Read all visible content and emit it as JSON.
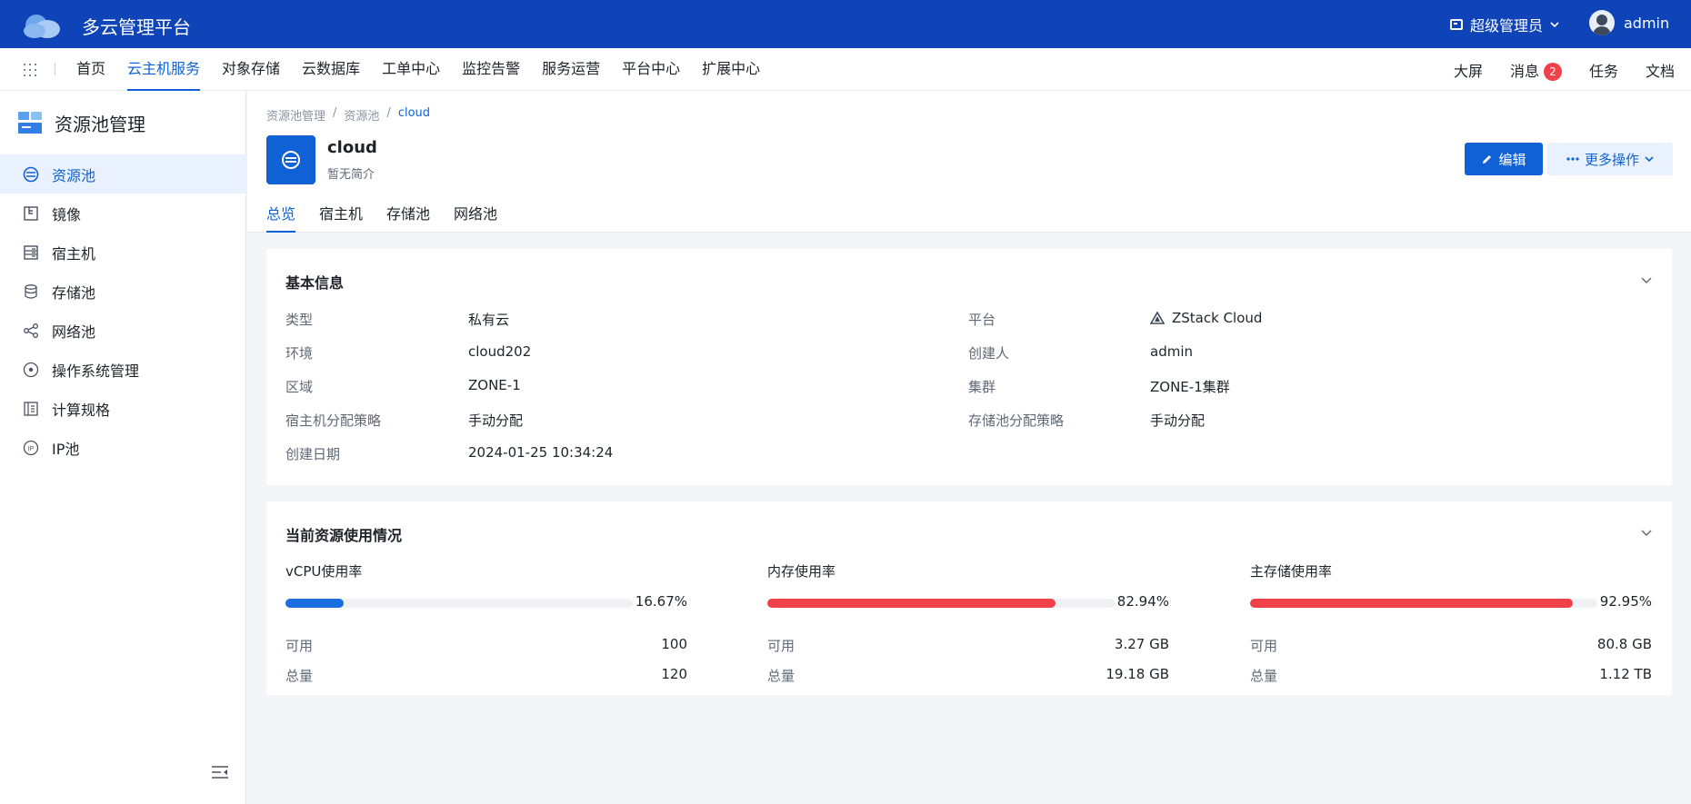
{
  "app": {
    "title": "多云管理平台"
  },
  "topbar": {
    "role": "超级管理员",
    "user": "admin"
  },
  "nav": {
    "items": [
      "首页",
      "云主机服务",
      "对象存储",
      "云数据库",
      "工单中心",
      "监控告警",
      "服务运营",
      "平台中心",
      "扩展中心"
    ],
    "active_index": 1,
    "right": {
      "screen": "大屏",
      "messages": "消息",
      "message_count": "2",
      "tasks": "任务",
      "docs": "文档"
    }
  },
  "sidebar": {
    "title": "资源池管理",
    "items": [
      {
        "label": "资源池",
        "icon": "resource-pool-icon",
        "active": true
      },
      {
        "label": "镜像",
        "icon": "image-icon"
      },
      {
        "label": "宿主机",
        "icon": "host-icon"
      },
      {
        "label": "存储池",
        "icon": "storage-pool-icon"
      },
      {
        "label": "网络池",
        "icon": "network-pool-icon"
      },
      {
        "label": "操作系统管理",
        "icon": "os-icon"
      },
      {
        "label": "计算规格",
        "icon": "compute-spec-icon"
      },
      {
        "label": "IP池",
        "icon": "ip-pool-icon"
      }
    ]
  },
  "breadcrumb": [
    "资源池管理",
    "/",
    "资源池",
    "/",
    "cloud"
  ],
  "resource": {
    "name": "cloud",
    "description": "暂无简介"
  },
  "actions": {
    "edit": "编辑",
    "more": "更多操作"
  },
  "tabs": [
    "总览",
    "宿主机",
    "存储池",
    "网络池"
  ],
  "basic_info": {
    "title": "基本信息",
    "left": [
      {
        "label": "类型",
        "value": "私有云"
      },
      {
        "label": "环境",
        "value": "cloud202"
      },
      {
        "label": "区域",
        "value": "ZONE-1"
      },
      {
        "label": "宿主机分配策略",
        "value": "手动分配"
      },
      {
        "label": "创建日期",
        "value": "2024-01-25 10:34:24"
      }
    ],
    "right": [
      {
        "label": "平台",
        "value": "ZStack Cloud"
      },
      {
        "label": "创建人",
        "value": "admin"
      },
      {
        "label": "集群",
        "value": "ZONE-1集群"
      },
      {
        "label": "存储池分配策略",
        "value": "手动分配"
      }
    ]
  },
  "usage": {
    "title": "当前资源使用情况",
    "available_label": "可用",
    "total_label": "总量",
    "items": [
      {
        "title": "vCPU使用率",
        "percent": "16.67%",
        "fraction": 0.1667,
        "color": "#1a6fe0",
        "available": "100",
        "total": "120"
      },
      {
        "title": "内存使用率",
        "percent": "82.94%",
        "fraction": 0.8294,
        "color": "#f0414a",
        "available": "3.27 GB",
        "total": "19.18 GB"
      },
      {
        "title": "主存储使用率",
        "percent": "92.95%",
        "fraction": 0.9295,
        "color": "#f0414a",
        "available": "80.8 GB",
        "total": "1.12 TB"
      }
    ]
  },
  "colors": {
    "brand": "#0f44b8",
    "accent": "#1061d6",
    "danger": "#f0414a"
  }
}
